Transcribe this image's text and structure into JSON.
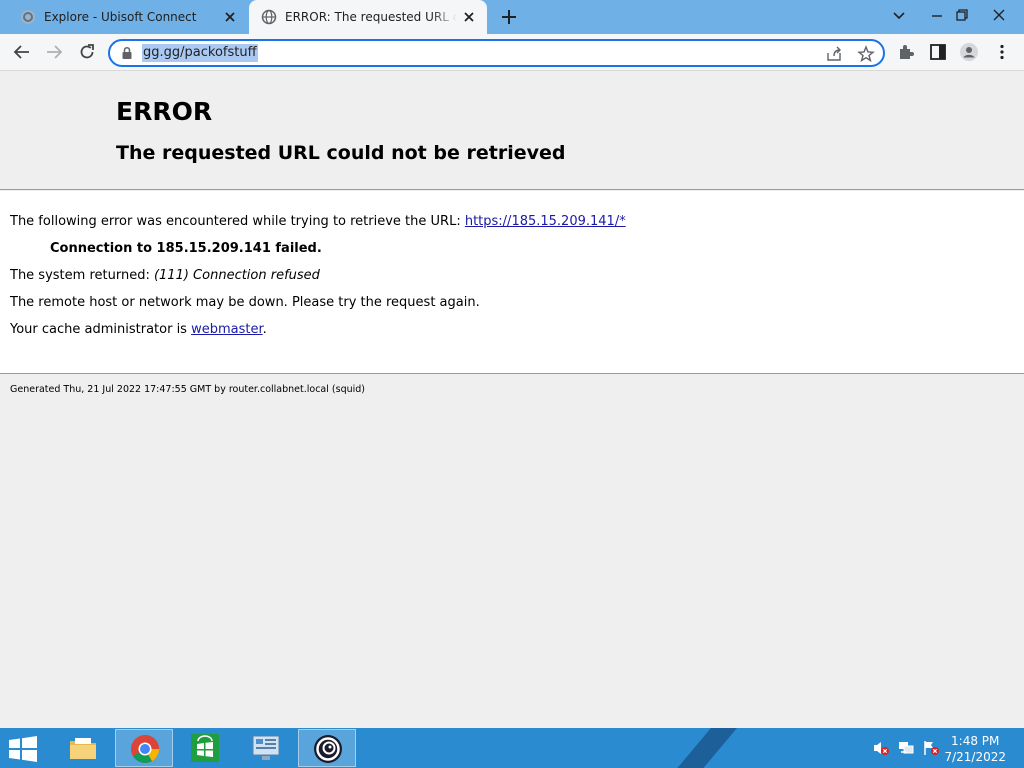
{
  "browser": {
    "tabs": [
      {
        "title": "Explore - Ubisoft Connect",
        "active": false
      },
      {
        "title": "ERROR: The requested URL could not be retrieved",
        "active": true
      }
    ],
    "address": "gg.gg/packofstuff"
  },
  "error_page": {
    "title": "ERROR",
    "subtitle": "The requested URL could not be retrieved",
    "intro": "The following error was encountered while trying to retrieve the URL:",
    "url_link": "https://185.15.209.141/*",
    "connection_failed": "Connection to 185.15.209.141 failed.",
    "system_returned_label": "The system returned:",
    "system_returned_value": "(111) Connection refused",
    "remote_host_msg": "The remote host or network may be down. Please try the request again.",
    "cache_admin_prefix": "Your cache administrator is",
    "cache_admin_link": "webmaster",
    "cache_admin_suffix": ".",
    "generated": "Generated Thu, 21 Jul 2022 17:47:55 GMT by router.collabnet.local (squid)"
  },
  "taskbar": {
    "apps": [
      "file-explorer",
      "chrome",
      "store",
      "control-panel",
      "ubisoft-connect"
    ],
    "time": "1:48 PM",
    "date": "7/21/2022"
  },
  "colors": {
    "titlebar": "#6fb0e6",
    "omnibox_border": "#1a73e8",
    "link": "#1a1aa6",
    "taskbar": "#2b8bd0"
  }
}
